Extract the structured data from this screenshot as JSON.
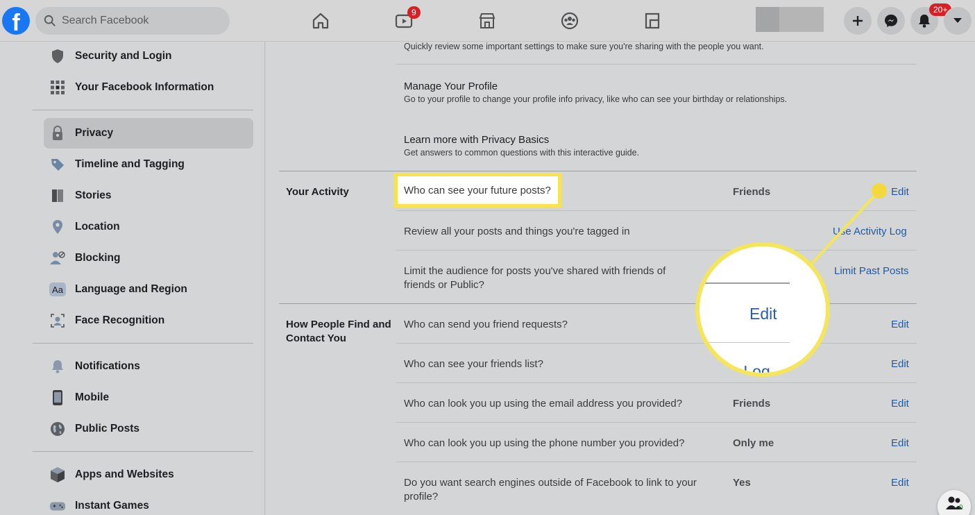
{
  "topbar": {
    "search_placeholder": "Search Facebook",
    "watch_badge": "9",
    "notifications_badge": "20+"
  },
  "sidebar": {
    "items": [
      {
        "label": "Security and Login",
        "icon": "shield-icon"
      },
      {
        "label": "Your Facebook Information",
        "icon": "grid-icon"
      },
      {
        "label": "Privacy",
        "icon": "lock-person-icon",
        "active": true
      },
      {
        "label": "Timeline and Tagging",
        "icon": "tag-icon"
      },
      {
        "label": "Stories",
        "icon": "book-icon"
      },
      {
        "label": "Location",
        "icon": "location-pin-icon"
      },
      {
        "label": "Blocking",
        "icon": "blocked-user-icon"
      },
      {
        "label": "Language and Region",
        "icon": "language-icon"
      },
      {
        "label": "Face Recognition",
        "icon": "face-scan-icon"
      },
      {
        "label": "Notifications",
        "icon": "bell-icon"
      },
      {
        "label": "Mobile",
        "icon": "phone-icon"
      },
      {
        "label": "Public Posts",
        "icon": "globe-icon"
      },
      {
        "label": "Apps and Websites",
        "icon": "cube-icon"
      },
      {
        "label": "Instant Games",
        "icon": "gamepad-icon"
      }
    ]
  },
  "main": {
    "top_desc": "Quickly review some important settings to make sure you're sharing with the people you want.",
    "shortcuts": [
      {
        "title": "Manage Your Profile",
        "desc": "Go to your profile to change your profile info privacy, like who can see your birthday or relationships."
      },
      {
        "title": "Learn more with Privacy Basics",
        "desc": "Get answers to common questions with this interactive guide."
      }
    ],
    "your_activity": {
      "heading": "Your Activity",
      "rows": [
        {
          "question": "Who can see your future posts?",
          "value": "Friends",
          "action": "Edit"
        },
        {
          "question": "Review all your posts and things you're tagged in",
          "value": "",
          "action": "Use Activity Log"
        },
        {
          "question_line1": "Limit the audience for posts you've shared with friends of",
          "question_line2": "friends or Public?",
          "value": "",
          "action": "Limit Past Posts"
        }
      ]
    },
    "find_contact": {
      "heading_line1": "How People Find and",
      "heading_line2": "Contact You",
      "rows": [
        {
          "question": "Who can send you friend requests?",
          "value": "",
          "action": "Edit"
        },
        {
          "question": "Who can see your friends list?",
          "value": "",
          "action": "Edit"
        },
        {
          "question": "Who can look you up using the email address you provided?",
          "value": "Friends",
          "action": "Edit"
        },
        {
          "question": "Who can look you up using the phone number you provided?",
          "value": "Only me",
          "action": "Edit"
        },
        {
          "question_line1": "Do you want search engines outside of Facebook to link to your",
          "question_line2": "profile?",
          "value": "Yes",
          "action": "Edit"
        }
      ]
    }
  },
  "callout": {
    "edit_label": "Edit",
    "partial_label": "ity Log",
    "highlight_color": "#f4e55a"
  },
  "contacts_badge": "0"
}
